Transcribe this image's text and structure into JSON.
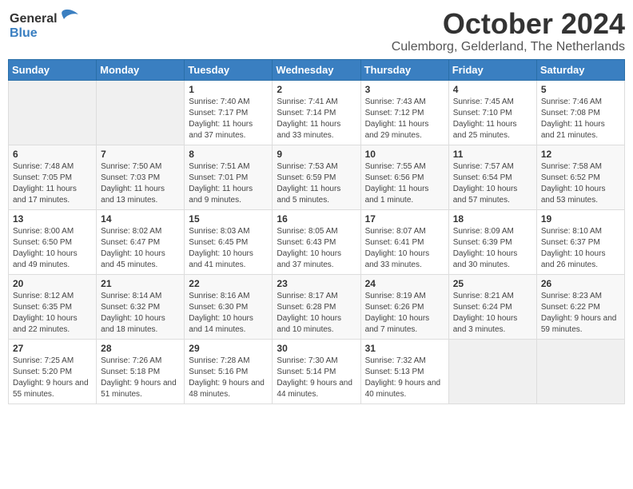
{
  "header": {
    "logo_general": "General",
    "logo_blue": "Blue",
    "month_title": "October 2024",
    "location": "Culemborg, Gelderland, The Netherlands"
  },
  "weekdays": [
    "Sunday",
    "Monday",
    "Tuesday",
    "Wednesday",
    "Thursday",
    "Friday",
    "Saturday"
  ],
  "weeks": [
    [
      {
        "day": "",
        "info": ""
      },
      {
        "day": "",
        "info": ""
      },
      {
        "day": "1",
        "info": "Sunrise: 7:40 AM\nSunset: 7:17 PM\nDaylight: 11 hours and 37 minutes."
      },
      {
        "day": "2",
        "info": "Sunrise: 7:41 AM\nSunset: 7:14 PM\nDaylight: 11 hours and 33 minutes."
      },
      {
        "day": "3",
        "info": "Sunrise: 7:43 AM\nSunset: 7:12 PM\nDaylight: 11 hours and 29 minutes."
      },
      {
        "day": "4",
        "info": "Sunrise: 7:45 AM\nSunset: 7:10 PM\nDaylight: 11 hours and 25 minutes."
      },
      {
        "day": "5",
        "info": "Sunrise: 7:46 AM\nSunset: 7:08 PM\nDaylight: 11 hours and 21 minutes."
      }
    ],
    [
      {
        "day": "6",
        "info": "Sunrise: 7:48 AM\nSunset: 7:05 PM\nDaylight: 11 hours and 17 minutes."
      },
      {
        "day": "7",
        "info": "Sunrise: 7:50 AM\nSunset: 7:03 PM\nDaylight: 11 hours and 13 minutes."
      },
      {
        "day": "8",
        "info": "Sunrise: 7:51 AM\nSunset: 7:01 PM\nDaylight: 11 hours and 9 minutes."
      },
      {
        "day": "9",
        "info": "Sunrise: 7:53 AM\nSunset: 6:59 PM\nDaylight: 11 hours and 5 minutes."
      },
      {
        "day": "10",
        "info": "Sunrise: 7:55 AM\nSunset: 6:56 PM\nDaylight: 11 hours and 1 minute."
      },
      {
        "day": "11",
        "info": "Sunrise: 7:57 AM\nSunset: 6:54 PM\nDaylight: 10 hours and 57 minutes."
      },
      {
        "day": "12",
        "info": "Sunrise: 7:58 AM\nSunset: 6:52 PM\nDaylight: 10 hours and 53 minutes."
      }
    ],
    [
      {
        "day": "13",
        "info": "Sunrise: 8:00 AM\nSunset: 6:50 PM\nDaylight: 10 hours and 49 minutes."
      },
      {
        "day": "14",
        "info": "Sunrise: 8:02 AM\nSunset: 6:47 PM\nDaylight: 10 hours and 45 minutes."
      },
      {
        "day": "15",
        "info": "Sunrise: 8:03 AM\nSunset: 6:45 PM\nDaylight: 10 hours and 41 minutes."
      },
      {
        "day": "16",
        "info": "Sunrise: 8:05 AM\nSunset: 6:43 PM\nDaylight: 10 hours and 37 minutes."
      },
      {
        "day": "17",
        "info": "Sunrise: 8:07 AM\nSunset: 6:41 PM\nDaylight: 10 hours and 33 minutes."
      },
      {
        "day": "18",
        "info": "Sunrise: 8:09 AM\nSunset: 6:39 PM\nDaylight: 10 hours and 30 minutes."
      },
      {
        "day": "19",
        "info": "Sunrise: 8:10 AM\nSunset: 6:37 PM\nDaylight: 10 hours and 26 minutes."
      }
    ],
    [
      {
        "day": "20",
        "info": "Sunrise: 8:12 AM\nSunset: 6:35 PM\nDaylight: 10 hours and 22 minutes."
      },
      {
        "day": "21",
        "info": "Sunrise: 8:14 AM\nSunset: 6:32 PM\nDaylight: 10 hours and 18 minutes."
      },
      {
        "day": "22",
        "info": "Sunrise: 8:16 AM\nSunset: 6:30 PM\nDaylight: 10 hours and 14 minutes."
      },
      {
        "day": "23",
        "info": "Sunrise: 8:17 AM\nSunset: 6:28 PM\nDaylight: 10 hours and 10 minutes."
      },
      {
        "day": "24",
        "info": "Sunrise: 8:19 AM\nSunset: 6:26 PM\nDaylight: 10 hours and 7 minutes."
      },
      {
        "day": "25",
        "info": "Sunrise: 8:21 AM\nSunset: 6:24 PM\nDaylight: 10 hours and 3 minutes."
      },
      {
        "day": "26",
        "info": "Sunrise: 8:23 AM\nSunset: 6:22 PM\nDaylight: 9 hours and 59 minutes."
      }
    ],
    [
      {
        "day": "27",
        "info": "Sunrise: 7:25 AM\nSunset: 5:20 PM\nDaylight: 9 hours and 55 minutes."
      },
      {
        "day": "28",
        "info": "Sunrise: 7:26 AM\nSunset: 5:18 PM\nDaylight: 9 hours and 51 minutes."
      },
      {
        "day": "29",
        "info": "Sunrise: 7:28 AM\nSunset: 5:16 PM\nDaylight: 9 hours and 48 minutes."
      },
      {
        "day": "30",
        "info": "Sunrise: 7:30 AM\nSunset: 5:14 PM\nDaylight: 9 hours and 44 minutes."
      },
      {
        "day": "31",
        "info": "Sunrise: 7:32 AM\nSunset: 5:13 PM\nDaylight: 9 hours and 40 minutes."
      },
      {
        "day": "",
        "info": ""
      },
      {
        "day": "",
        "info": ""
      }
    ]
  ]
}
